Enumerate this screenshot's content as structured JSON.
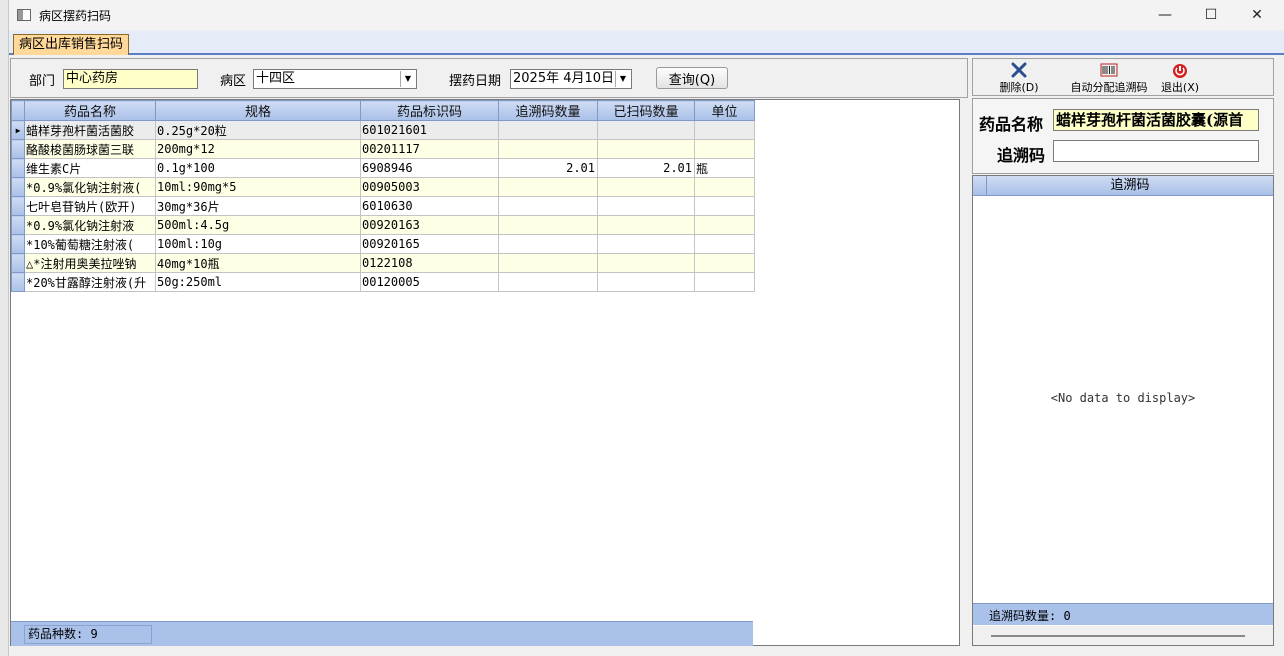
{
  "window": {
    "title": "病区摆药扫码",
    "minimize": "—",
    "maximize": "☐",
    "close": "✕"
  },
  "tab": {
    "label": "病区出库销售扫码"
  },
  "filters": {
    "dept_label": "部门",
    "dept_value": "中心药房",
    "ward_label": "病区",
    "ward_value": "十四区",
    "date_label": "摆药日期",
    "date_value": "2025年 4月10日",
    "query_button": "查询(Q)"
  },
  "grid": {
    "columns": [
      "药品名称",
      "规格",
      "药品标识码",
      "追溯码数量",
      "已扫码数量",
      "单位"
    ],
    "rows": [
      [
        "蜡样芽孢杆菌活菌胶",
        "0.25g*20粒",
        "601021601",
        "",
        "",
        ""
      ],
      [
        "酪酸梭菌肠球菌三联",
        "200mg*12",
        "00201117",
        "",
        "",
        ""
      ],
      [
        "维生素C片",
        "0.1g*100",
        "6908946",
        "2.01",
        "2.01",
        "瓶"
      ],
      [
        "*0.9%氯化钠注射液(",
        "10ml:90mg*5",
        "00905003",
        "",
        "",
        ""
      ],
      [
        "七叶皂苷钠片(欧开)",
        "30mg*36片",
        "6010630",
        "",
        "",
        ""
      ],
      [
        "*0.9%氯化钠注射液",
        "500ml:4.5g",
        "00920163",
        "",
        "",
        ""
      ],
      [
        "*10%葡萄糖注射液(",
        "100ml:10g",
        "00920165",
        "",
        "",
        ""
      ],
      [
        "△*注射用奥美拉唑钠",
        "40mg*10瓶",
        "0122108",
        "",
        "",
        ""
      ],
      [
        "*20%甘露醇注射液(升",
        "50g:250ml",
        "00120005",
        "",
        "",
        ""
      ]
    ],
    "footer_count": "药品种数: 9"
  },
  "toolbar": {
    "delete": "删除(D)",
    "auto_assign": "自动分配追溯码",
    "exit": "退出(X)"
  },
  "detail": {
    "drug_name_label": "药品名称",
    "drug_name_value": "蜡样芽孢杆菌活菌胶囊(源首",
    "trace_label": "追溯码",
    "trace_value": ""
  },
  "trace_grid": {
    "column": "追溯码",
    "empty_text": "<No data to display>",
    "footer_count": "追溯码数量: 0"
  }
}
